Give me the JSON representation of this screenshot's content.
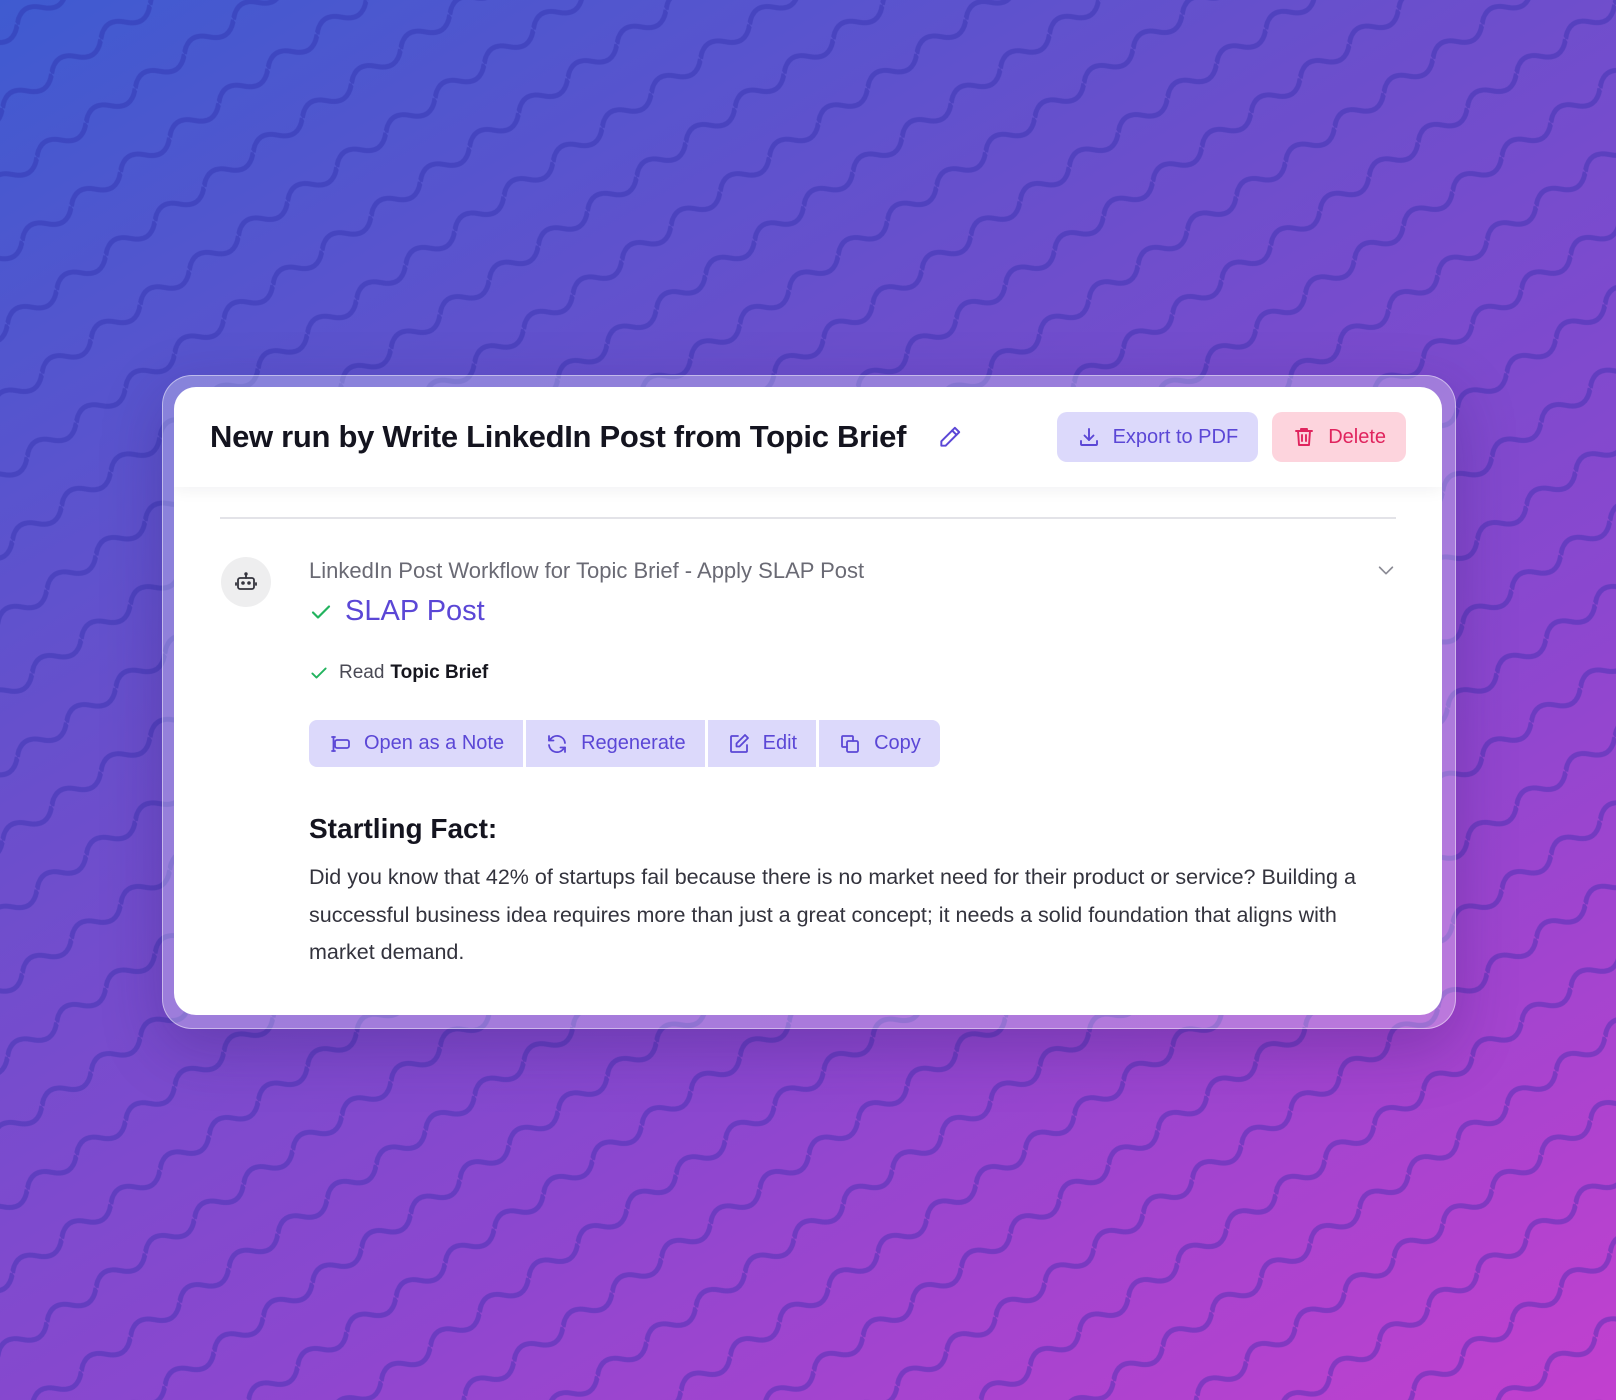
{
  "header": {
    "title": "New run by Write LinkedIn Post from Topic Brief",
    "export_label": "Export to PDF",
    "delete_label": "Delete"
  },
  "run": {
    "workflow_name": "LinkedIn Post Workflow for Topic Brief - Apply SLAP Post",
    "step_title": "SLAP Post",
    "read_prefix": "Read",
    "read_target": "Topic Brief"
  },
  "actions": {
    "open_note": "Open as a Note",
    "regenerate": "Regenerate",
    "edit": "Edit",
    "copy": "Copy"
  },
  "output": {
    "heading": "Startling Fact:",
    "paragraph": "Did you know that 42% of startups fail because there is no market need for their product or service? Building a successful business idea requires more than just a great concept; it needs a solid foundation that aligns with market demand."
  },
  "icons": {
    "title_edit": "pencil-icon",
    "export": "download-icon",
    "delete": "trash-icon",
    "avatar": "robot-icon",
    "expand": "chevron-down-icon",
    "check": "check-icon",
    "open_note": "note-icon",
    "regenerate": "refresh-icon",
    "edit": "edit-icon",
    "copy": "copy-icon"
  },
  "colors": {
    "accent": "#5b47d6",
    "accent_bg": "#dcd9fb",
    "danger": "#e0245e",
    "danger_bg": "#fdd4dd",
    "success": "#22b35e"
  }
}
